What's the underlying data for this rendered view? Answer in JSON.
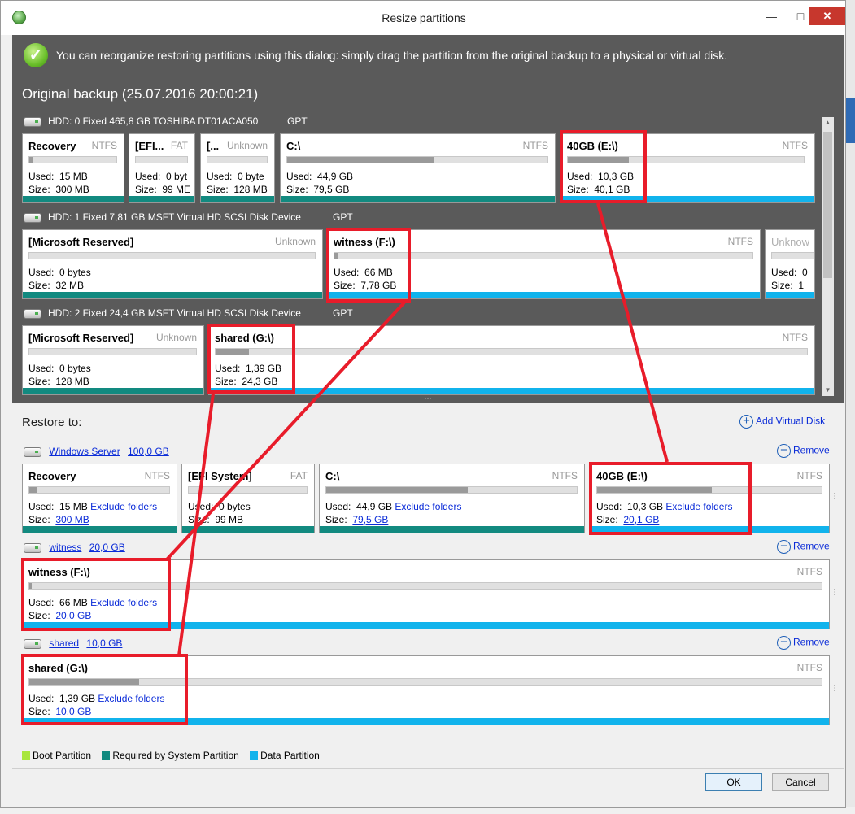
{
  "window": {
    "title": "Resize partitions",
    "controls": {
      "minimize": "—",
      "maximize": "□",
      "close": "✕"
    }
  },
  "info": {
    "icon": "check-circle-icon",
    "text": "You can reorganize restoring partitions using this dialog: simply drag the partition from the original backup to a physical or virtual disk."
  },
  "original": {
    "title": "Original backup (25.07.2016 20:00:21)",
    "disks": [
      {
        "label": "HDD: 0 Fixed 465,8 GB TOSHIBA DT01ACA050",
        "scheme": "GPT",
        "partitions": [
          {
            "name": "Recovery",
            "fs": "NTFS",
            "used_label": "Used:",
            "used": "15 MB",
            "size_label": "Size:",
            "size": "300 MB",
            "fill": 0.05,
            "type": "required"
          },
          {
            "name": "[EFI...",
            "fs": "FAT",
            "used_label": "Used:",
            "used": "0 byt",
            "size_label": "Size:",
            "size": "99 ME",
            "fill": 0,
            "type": "required"
          },
          {
            "name": "[...",
            "fs": "Unknown",
            "used_label": "Used:",
            "used": "0 byte",
            "size_label": "Size:",
            "size": "128 MB",
            "fill": 0,
            "type": "required"
          },
          {
            "name": "C:\\",
            "fs": "NTFS",
            "used_label": "Used:",
            "used": "44,9 GB",
            "size_label": "Size:",
            "size": "79,5 GB",
            "fill": 0.565,
            "type": "required"
          },
          {
            "name": "40GB (E:\\)",
            "fs": "NTFS",
            "used_label": "Used:",
            "used": "10,3 GB",
            "size_label": "Size:",
            "size": "40,1 GB",
            "fill": 0.257,
            "type": "data"
          }
        ]
      },
      {
        "label": "HDD: 1 Fixed 7,81 GB MSFT Virtual HD SCSI Disk Device",
        "scheme": "GPT",
        "partitions": [
          {
            "name": "[Microsoft Reserved]",
            "fs": "Unknown",
            "used_label": "Used:",
            "used": "0 bytes",
            "size_label": "Size:",
            "size": "32 MB",
            "fill": 0,
            "type": "required"
          },
          {
            "name": "witness (F:\\)",
            "fs": "NTFS",
            "used_label": "Used:",
            "used": "66 MB",
            "size_label": "Size:",
            "size": "7,78 GB",
            "fill": 0.008,
            "type": "data"
          },
          {
            "name": "Unknow",
            "fs": "",
            "used_label": "Used:",
            "used": "0",
            "size_label": "Size:",
            "size": "1",
            "fill": 0,
            "type": "data"
          }
        ]
      },
      {
        "label": "HDD: 2 Fixed 24,4 GB MSFT Virtual HD SCSI Disk Device",
        "scheme": "GPT",
        "partitions": [
          {
            "name": "[Microsoft Reserved]",
            "fs": "Unknown",
            "used_label": "Used:",
            "used": "0 bytes",
            "size_label": "Size:",
            "size": "128 MB",
            "fill": 0,
            "type": "required"
          },
          {
            "name": "shared (G:\\)",
            "fs": "NTFS",
            "used_label": "Used:",
            "used": "1,39 GB",
            "size_label": "Size:",
            "size": "24,3 GB",
            "fill": 0.057,
            "type": "data"
          }
        ]
      }
    ]
  },
  "restore": {
    "title": "Restore to:",
    "add_virtual_disk": "Add Virtual Disk",
    "remove_label": "Remove",
    "exclude_label": "Exclude folders",
    "disks": [
      {
        "name": "Windows Server",
        "capacity": "100,0 GB",
        "partitions": [
          {
            "name": "Recovery",
            "fs": "NTFS",
            "used_label": "Used:",
            "used": "15 MB",
            "size_label": "Size:",
            "size": "300 MB",
            "fill": 0.05,
            "type": "required"
          },
          {
            "name": "[EFI System]",
            "fs": "FAT",
            "used_label": "Used:",
            "used": "0 bytes",
            "size_label": "Size:",
            "size": "99 MB",
            "fill": 0,
            "type": "required"
          },
          {
            "name": "C:\\",
            "fs": "NTFS",
            "used_label": "Used:",
            "used": "44,9 GB",
            "size_label": "Size:",
            "size": "79,5 GB",
            "fill": 0.565,
            "type": "required"
          },
          {
            "name": "40GB (E:\\)",
            "fs": "NTFS",
            "used_label": "Used:",
            "used": "10,3 GB",
            "size_label": "Size:",
            "size": "20,1 GB",
            "fill": 0.51,
            "type": "data"
          }
        ]
      },
      {
        "name": "witness",
        "capacity": "20,0 GB",
        "partitions": [
          {
            "name": "witness (F:\\)",
            "fs": "NTFS",
            "used_label": "Used:",
            "used": "66 MB",
            "size_label": "Size:",
            "size": "20,0 GB",
            "fill": 0.003,
            "type": "data"
          }
        ]
      },
      {
        "name": "shared",
        "capacity": "10,0 GB",
        "partitions": [
          {
            "name": "shared (G:\\)",
            "fs": "NTFS",
            "used_label": "Used:",
            "used": "1,39 GB",
            "size_label": "Size:",
            "size": "10,0 GB",
            "fill": 0.139,
            "type": "data"
          }
        ]
      }
    ]
  },
  "legend": [
    {
      "label": "Boot Partition",
      "color": "#a8e63c"
    },
    {
      "label": "Required by System Partition",
      "color": "#128a80"
    },
    {
      "label": "Data Partition",
      "color": "#11b3ec"
    }
  ],
  "buttons": {
    "ok": "OK",
    "cancel": "Cancel"
  }
}
